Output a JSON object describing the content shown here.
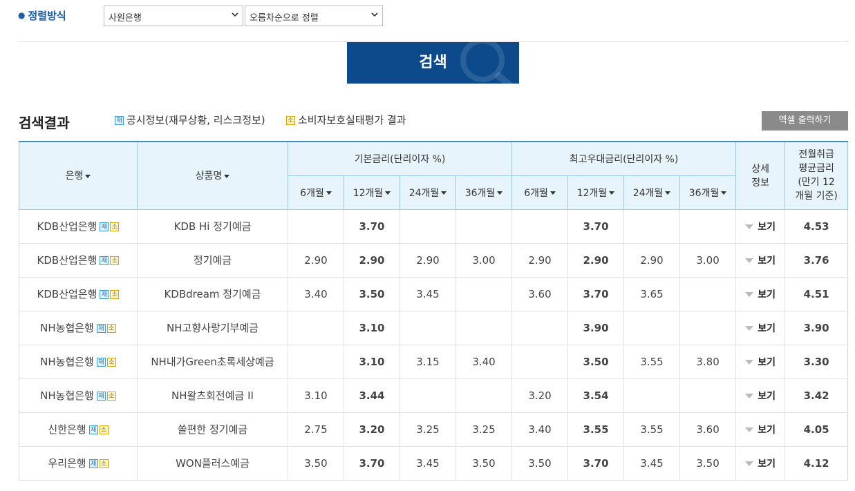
{
  "sort": {
    "title": "정렬방식",
    "select1": "사원은행",
    "select2": "오름차순으로 정렬"
  },
  "search_button": "검색",
  "results": {
    "title": "검색결과",
    "legend_jae_badge": "재",
    "legend_jae_text": "공시정보(재무상황, 리스크정보)",
    "legend_so_badge": "소",
    "legend_so_text": "소비자보호실태평가 결과",
    "excel_button": "엑셀 출력하기"
  },
  "table": {
    "headers": {
      "bank": "은행",
      "product": "상품명",
      "base_group": "기본금리(단리이자 %)",
      "max_group": "최고우대금리(단리이자 %)",
      "detail_line1": "상세",
      "detail_line2": "정보",
      "avg_line1": "전월취급",
      "avg_line2": "평균금리",
      "avg_line3": "(만기 12",
      "avg_line4": "개월 기준)",
      "periods": [
        "6개월",
        "12개월",
        "24개월",
        "36개월"
      ]
    },
    "badge_jae": "재",
    "badge_so": "소",
    "view_label": "보기",
    "rows": [
      {
        "bank": "KDB산업은행",
        "product": "KDB Hi 정기예금",
        "base": [
          "",
          "3.70",
          "",
          ""
        ],
        "max": [
          "",
          "3.70",
          "",
          ""
        ],
        "avg": "4.53"
      },
      {
        "bank": "KDB산업은행",
        "product": "정기예금",
        "base": [
          "2.90",
          "2.90",
          "2.90",
          "3.00"
        ],
        "max": [
          "2.90",
          "2.90",
          "2.90",
          "3.00"
        ],
        "avg": "3.76"
      },
      {
        "bank": "KDB산업은행",
        "product": "KDBdream 정기예금",
        "base": [
          "3.40",
          "3.50",
          "3.45",
          ""
        ],
        "max": [
          "3.60",
          "3.70",
          "3.65",
          ""
        ],
        "avg": "4.51"
      },
      {
        "bank": "NH농협은행",
        "product": "NH고향사랑기부예금",
        "base": [
          "",
          "3.10",
          "",
          ""
        ],
        "max": [
          "",
          "3.90",
          "",
          ""
        ],
        "avg": "3.90"
      },
      {
        "bank": "NH농협은행",
        "product": "NH내가Green초록세상예금",
        "base": [
          "",
          "3.10",
          "3.15",
          "3.40"
        ],
        "max": [
          "",
          "3.50",
          "3.55",
          "3.80"
        ],
        "avg": "3.30"
      },
      {
        "bank": "NH농협은행",
        "product": "NH왈츠회전예금 II",
        "base": [
          "3.10",
          "3.44",
          "",
          ""
        ],
        "max": [
          "3.20",
          "3.54",
          "",
          ""
        ],
        "avg": "3.42"
      },
      {
        "bank": "신한은행",
        "product": "쏠편한 정기예금",
        "base": [
          "2.75",
          "3.20",
          "3.25",
          "3.25"
        ],
        "max": [
          "3.40",
          "3.55",
          "3.55",
          "3.60"
        ],
        "avg": "4.05"
      },
      {
        "bank": "우리은행",
        "product": "WON플러스예금",
        "base": [
          "3.50",
          "3.70",
          "3.45",
          "3.50"
        ],
        "max": [
          "3.50",
          "3.70",
          "3.45",
          "3.50"
        ],
        "avg": "4.12"
      }
    ]
  },
  "colors": {
    "accent": "#0d4a8c",
    "header_bg": "#e8f4fb",
    "excel_btn": "#8a8a8a"
  }
}
